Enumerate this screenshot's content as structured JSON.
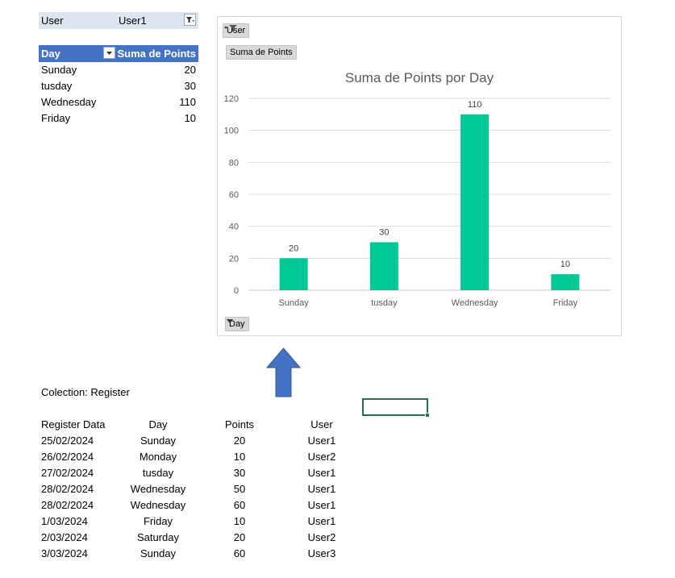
{
  "filter": {
    "label": "User",
    "value": "User1"
  },
  "pivot": {
    "headers": [
      "Day",
      "Suma de Points"
    ],
    "rows": [
      {
        "day": "Sunday",
        "points": "20"
      },
      {
        "day": "tusday",
        "points": "30"
      },
      {
        "day": "Wednesday",
        "points": "110"
      },
      {
        "day": "Friday",
        "points": "10"
      }
    ]
  },
  "chart_buttons": {
    "user": "User",
    "measure": "Suma de Points",
    "axis": "Day"
  },
  "chart_data": {
    "type": "bar",
    "title": "Suma de Points por Day",
    "categories": [
      "Sunday",
      "tusday",
      "Wednesday",
      "Friday"
    ],
    "values": [
      20,
      30,
      110,
      10
    ],
    "ylim": [
      0,
      120
    ],
    "yticks": [
      0,
      20,
      40,
      60,
      80,
      100,
      120
    ],
    "grid": true,
    "bar_color": "#00c896",
    "data_labels": true
  },
  "register": {
    "title": "Colection: Register",
    "headers": [
      "Register Data",
      "Day",
      "Points",
      "User"
    ],
    "rows": [
      [
        "25/02/2024",
        "Sunday",
        "20",
        "User1"
      ],
      [
        "26/02/2024",
        "Monday",
        "10",
        "User2"
      ],
      [
        "27/02/2024",
        "tusday",
        "30",
        "User1"
      ],
      [
        "28/02/2024",
        "Wednesday",
        "50",
        "User1"
      ],
      [
        "28/02/2024",
        "Wednesday",
        "60",
        "User1"
      ],
      [
        "1/03/2024",
        "Friday",
        "10",
        "User1"
      ],
      [
        "2/03/2024",
        "Saturday",
        "20",
        "User2"
      ],
      [
        "3/03/2024",
        "Sunday",
        "60",
        "User3"
      ]
    ]
  },
  "colors": {
    "header_blue": "#4472c4",
    "filter_bg": "#dce6f1",
    "arrow_blue": "#4472c4",
    "selection_green": "#217346"
  }
}
